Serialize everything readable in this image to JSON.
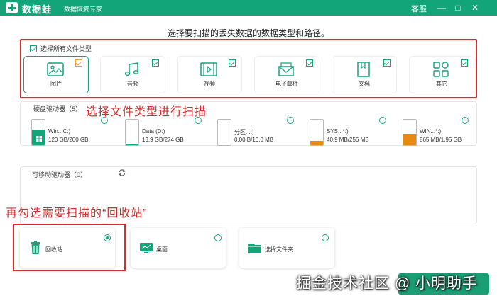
{
  "titlebar": {
    "app_name": "数据蛙",
    "app_sub": "数据恢复专家",
    "support": "客服",
    "minimize": "—",
    "maximize": "□",
    "close": "✕"
  },
  "heading": "选择要扫描的丢失数据的数据类型和路径。",
  "file_types": {
    "select_all": "选择所有文件类型",
    "items": [
      {
        "label": "图片",
        "icon": "image-icon"
      },
      {
        "label": "音频",
        "icon": "music-icon"
      },
      {
        "label": "视频",
        "icon": "video-icon"
      },
      {
        "label": "电子邮件",
        "icon": "mail-icon"
      },
      {
        "label": "文档",
        "icon": "document-icon"
      },
      {
        "label": "其它",
        "icon": "other-icon"
      }
    ]
  },
  "annotations": {
    "file_types": "选择文件类型进行扫描",
    "recycle": "再勾选需要扫描的“回收站”"
  },
  "hard_drives": {
    "label": "硬盘驱动器（5）",
    "items": [
      {
        "name": "Win...C:)",
        "size": "120 GB/200 GB",
        "fill": 0.6,
        "color": "#13a57a"
      },
      {
        "name": "Data (D:)",
        "size": "13.9 GB/274 GB",
        "fill": 0.05,
        "color": "#13a57a"
      },
      {
        "name": "分区...:)",
        "size": "0.00  B/16.0 MB",
        "fill": 0.0,
        "color": "#13a57a"
      },
      {
        "name": "SYS...*:)",
        "size": "40.9 MB/256 MB",
        "fill": 0.16,
        "color": "#e58a14"
      },
      {
        "name": "WIN...*:)",
        "size": "865 MB/1.95 GB",
        "fill": 0.44,
        "color": "#e58a14"
      }
    ]
  },
  "removable": {
    "label": "可移动驱动器（0）"
  },
  "locations": [
    {
      "label": "回收站",
      "icon": "recycle-bin-icon",
      "selected": true
    },
    {
      "label": "桌面",
      "icon": "desktop-icon",
      "selected": false
    },
    {
      "label": "选择文件夹",
      "icon": "folder-icon",
      "selected": false
    }
  ],
  "watermark": "掘金技术社区 @ 小明助手",
  "colors": {
    "brand": "#13a57a",
    "annotation": "#d82c2c",
    "orange": "#e58a14"
  }
}
